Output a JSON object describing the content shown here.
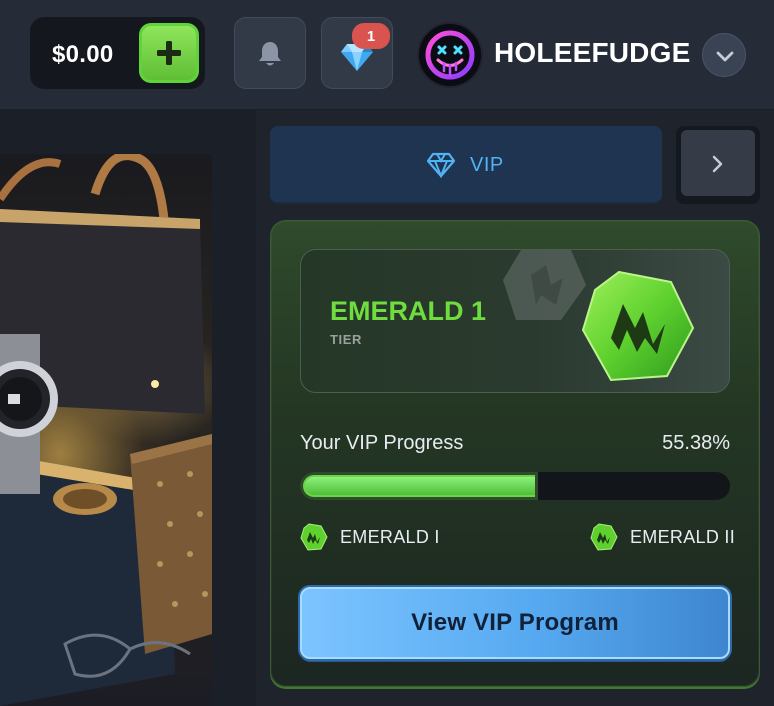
{
  "header": {
    "balance": "$0.00",
    "notifications_badge": "1",
    "username": "HOLEEFUDGE"
  },
  "vip_nav": {
    "active_tab_label": "VIP"
  },
  "vip_card": {
    "tier_name": "EMERALD 1",
    "tier_caption": "TIER",
    "progress_label": "Your VIP Progress",
    "progress_value": "55.38%",
    "progress_fraction": 0.5538,
    "current_level": "EMERALD I",
    "next_level": "EMERALD II",
    "view_button_label": "View VIP Program"
  },
  "colors": {
    "accent_green": "#6fdc3f",
    "accent_blue": "#4fb3f4",
    "badge_red": "#d9534f",
    "button_blue": "#56a9f0"
  },
  "icons": {
    "deposit": "plus-icon",
    "notifications": "bell-icon",
    "vip": "diamond-icon",
    "user_menu": "chevron-down-icon",
    "next": "chevron-right-icon",
    "tier": "emerald-hexagon-icon"
  }
}
